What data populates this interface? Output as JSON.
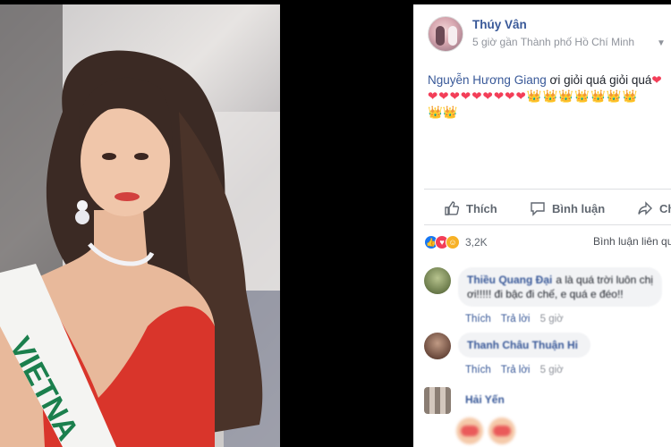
{
  "post": {
    "author": "Thúy Vân",
    "meta": "5 giờ gần Thành phố Hồ Chí Minh",
    "text_mention": "Nguyễn Hương Giang",
    "text_rest": " ơi giỏi quá giỏi quá",
    "emoji_line1_trail": "❤",
    "emoji_line2": "❤❤❤❤❤❤❤❤❤👑👑👑👑👑👑👑",
    "emoji_line3": "👑👑"
  },
  "actions": {
    "like_label": "Thích",
    "comment_label": "Bình luận",
    "share_label": "Chia sẻ"
  },
  "reactions": {
    "count": "3,2K",
    "comments_link": "Bình luận liên quan",
    "icons": [
      "like-icon",
      "love-icon",
      "haha-icon"
    ]
  },
  "comments": [
    {
      "name": "Thiều Quang Đại",
      "text_line1": "a là quá trời luôn chị",
      "text_line2": "ơi!!!!! đi bậc đi chế, e quá e đéo!!",
      "action_like": "Thích",
      "action_reply": "Trả lời",
      "time": "5 giờ"
    },
    {
      "name": "Thanh Châu Thuận Hi",
      "text_line1": "",
      "action_like": "Thích",
      "action_reply": "Trả lời",
      "time": "5 giờ"
    },
    {
      "name": "Hải Yến",
      "text_line1": ""
    }
  ],
  "colors": {
    "link": "#385898",
    "muted": "#90949c",
    "action_text": "#606770",
    "divider": "#dddfe2",
    "viewer_bg": "#000000"
  }
}
